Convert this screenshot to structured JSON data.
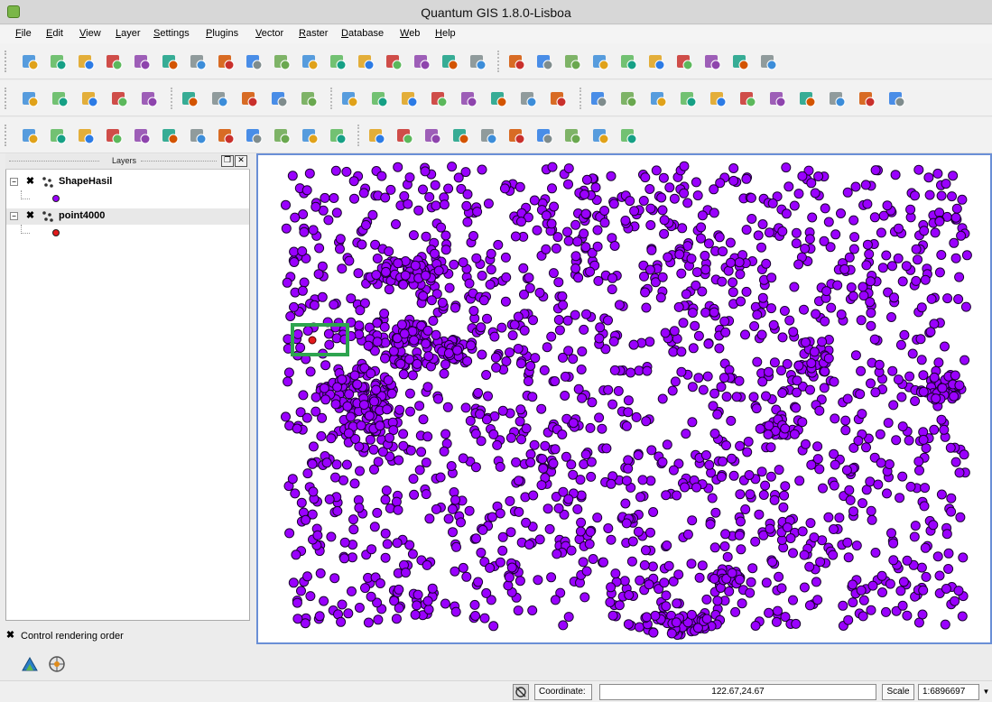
{
  "window": {
    "title": "Quantum GIS 1.8.0-Lisboa"
  },
  "menu": [
    "File",
    "Edit",
    "View",
    "Layer",
    "Settings",
    "Plugins",
    "Vector",
    "Raster",
    "Database",
    "Web",
    "Help"
  ],
  "toolbars": {
    "row1": [
      "new-project-icon",
      "open-project-icon",
      "save-project-icon",
      "save-as-icon",
      "print-composer-icon",
      "print-icon",
      "add-vector-layer-icon",
      "add-raster-layer-icon",
      "add-postgis-layer-icon",
      "add-spatialite-layer-icon",
      "add-mssql-layer-icon",
      "add-wms-layer-icon",
      "add-wfs-layer-icon",
      "new-shapefile-icon",
      "remove-layer-icon",
      "add-text-layer-icon",
      "new-layer-icon",
      "database-icon",
      "toggle-editing-icon",
      "save-edits-icon",
      "add-feature-icon",
      "move-feature-icon",
      "node-tool-icon",
      "delete-selected-icon",
      "cut-features-icon",
      "copy-features-icon",
      "paste-features-icon"
    ],
    "row2": [
      "layer-style-icon",
      "layer-add-icon",
      "layer-remove-icon",
      "gps-icon",
      "plugin-icon",
      "plugin2-icon",
      "digitize-icon",
      "digitize2-icon",
      "table-icon",
      "table2-icon",
      "label-icon",
      "rotate-icon",
      "rotate2-icon",
      "offset-icon",
      "measure-icon",
      "measure2-icon",
      "globe-icon",
      "raster-calc-icon",
      "pan-icon",
      "pan-to-selection-icon",
      "zoom-in-icon",
      "zoom-out-icon",
      "zoom-actual-icon",
      "zoom-full-icon",
      "zoom-to-selection-icon",
      "zoom-to-layer-icon",
      "zoom-last-icon",
      "zoom-next-icon",
      "refresh-icon"
    ],
    "row3": [
      "undo-icon",
      "redo-icon",
      "simplify-icon",
      "add-ring-icon",
      "add-part-icon",
      "delete-ring-icon",
      "delete-part-icon",
      "reshape-icon",
      "split-icon",
      "merge-icon",
      "merge-attrs-icon",
      "rotate-point-icon",
      "identify-icon",
      "run-action-icon",
      "select-icon",
      "deselect-icon",
      "attribute-table-icon",
      "measure-line-icon",
      "map-tips-icon",
      "bookmark-new-icon",
      "bookmark-show-icon",
      "text-annotation-icon"
    ]
  },
  "layers_panel": {
    "title": "Layers",
    "layers": [
      {
        "name": "ShapeHasil",
        "checked": true,
        "symbol_color": "#9a00ff"
      },
      {
        "name": "point4000",
        "checked": true,
        "symbol_color": "#e31a1c"
      }
    ]
  },
  "control_rendering_order": {
    "label": "Control rendering order",
    "checked": true
  },
  "map": {
    "point_fill": "#9a00ff",
    "point_stroke": "#1a0030",
    "highlight_point_fill": "#e31a1c",
    "selection_rect_color": "#2ea44f"
  },
  "statusbar": {
    "coordinate_label": "Coordinate:",
    "coordinate_value": "122.67,24.67",
    "scale_label": "Scale",
    "scale_value": "1:6896697"
  }
}
